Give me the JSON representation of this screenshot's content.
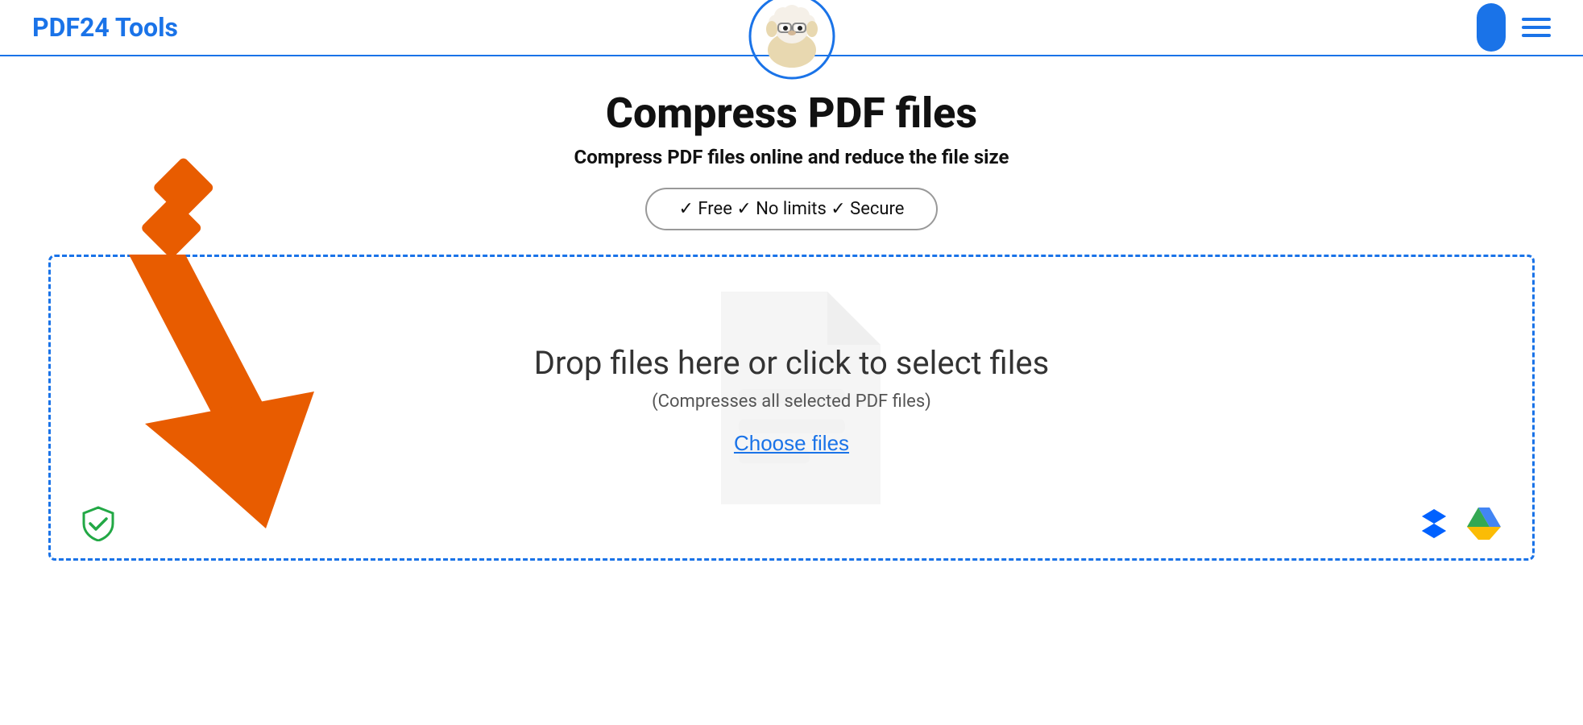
{
  "header": {
    "logo_text": "PDF24 Tools",
    "user_icon_label": "user-account",
    "hamburger_label": "menu"
  },
  "main": {
    "title": "Compress PDF files",
    "subtitle": "Compress PDF files online and reduce the file size",
    "features_badge": "✓ Free  ✓ No limits  ✓ Secure",
    "drop_zone": {
      "drop_text": "Drop files here or click to select files",
      "drop_subtext": "(Compresses all selected PDF files)",
      "choose_files_label": "Choose files"
    }
  },
  "bottom": {
    "shield_label": "security-verified",
    "dropbox_label": "dropbox-upload",
    "drive_label": "google-drive-upload"
  }
}
